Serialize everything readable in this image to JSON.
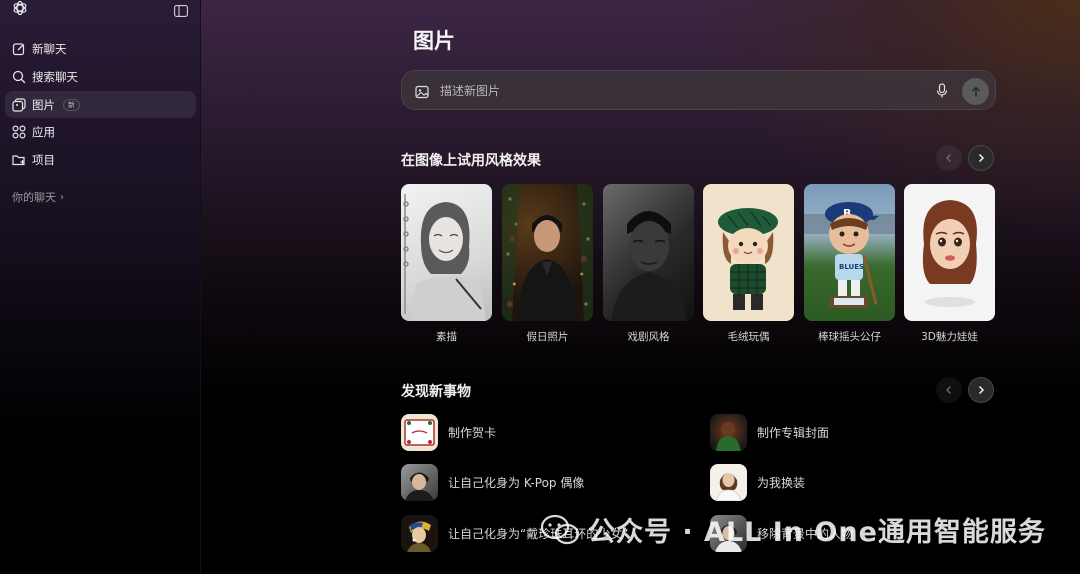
{
  "sidebar": {
    "items": [
      {
        "label": "新聊天",
        "icon": "new-chat-icon"
      },
      {
        "label": "搜索聊天",
        "icon": "search-icon"
      },
      {
        "label": "图片",
        "icon": "images-icon",
        "badge": "新",
        "active": true
      },
      {
        "label": "应用",
        "icon": "apps-icon"
      },
      {
        "label": "项目",
        "icon": "folder-plus-icon"
      }
    ],
    "section_label": "你的聊天",
    "section_chevron": "›"
  },
  "main": {
    "title": "图片",
    "search": {
      "placeholder": "描述新图片"
    },
    "styles_section": {
      "title": "在图像上试用风格效果",
      "cards": [
        {
          "label": "素描"
        },
        {
          "label": "假日照片"
        },
        {
          "label": "戏剧风格"
        },
        {
          "label": "毛绒玩偶"
        },
        {
          "label": "棒球摇头公仔"
        },
        {
          "label": "3D魅力娃娃"
        }
      ]
    },
    "discover_section": {
      "title": "发现新事物",
      "items": [
        {
          "label": "制作贺卡"
        },
        {
          "label": "制作专辑封面"
        },
        {
          "label": "让自己化身为 K-Pop 偶像"
        },
        {
          "label": "为我换装"
        },
        {
          "label": "让自己化身为“戴珍珠耳环的少女”"
        },
        {
          "label": "移除背景中的人物"
        }
      ]
    }
  },
  "watermark": {
    "text": "公众号 · ALL In One通用智能服务"
  },
  "colors": {
    "accent_bg": "#3c2645",
    "sidebar_active": "rgba(255,255,255,0.08)"
  }
}
